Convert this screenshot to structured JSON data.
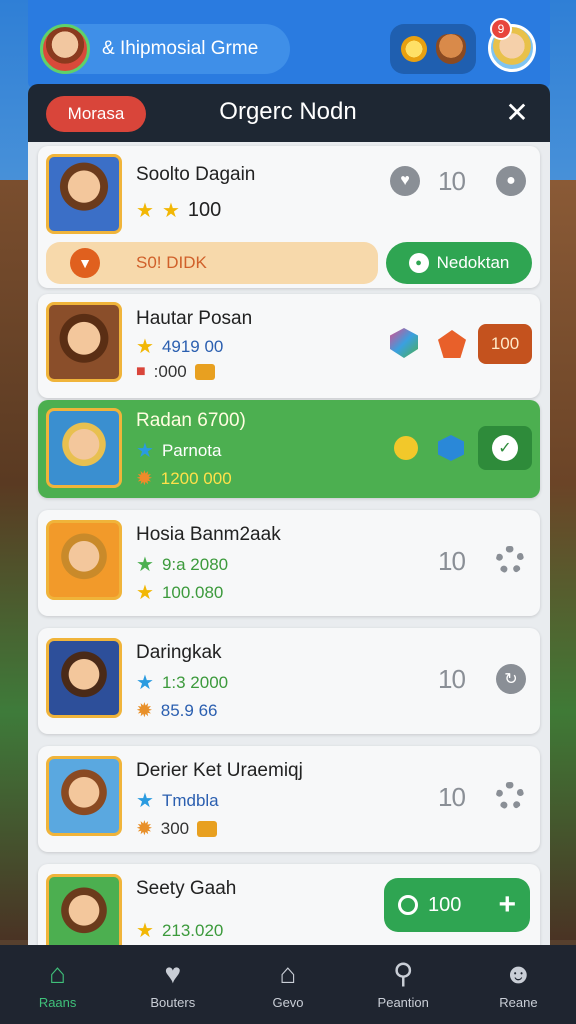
{
  "header": {
    "profile_name": "& Ihipmosial Grme",
    "notification_count": "9"
  },
  "panel": {
    "tag": "Morasa",
    "title": "Orgerc Nodn",
    "close": "✕"
  },
  "cards": [
    {
      "name": "Soolto Dagain",
      "stat1": "100",
      "count": "10",
      "status_text": "S0! DIDK",
      "action_label": "Nedoktan"
    },
    {
      "name": "Hautar Posan",
      "stat1": "4919 00",
      "stat2": ":000",
      "price": "100"
    },
    {
      "name": "Radan 6700)",
      "stat1": "Parnota",
      "stat2": "1200 000"
    },
    {
      "name": "Hosia Banm2aak",
      "stat1": "9:a 2080",
      "stat2": "100.080",
      "count": "10"
    },
    {
      "name": "Daringkak",
      "stat1": "1:3 2000",
      "stat2": "85.9 66",
      "count": "10"
    },
    {
      "name": "Derier Ket Uraemiqj",
      "stat1": "Tmdbla",
      "stat2": "300",
      "count": "10"
    },
    {
      "name": "Seety Gaah",
      "stat1": "213.020",
      "buy_value": "100",
      "buy_plus": "+"
    }
  ],
  "nav": [
    {
      "label": "Raans",
      "icon": "home-icon",
      "active": true
    },
    {
      "label": "Bouters",
      "icon": "heart-shield-icon",
      "active": false
    },
    {
      "label": "Gevo",
      "icon": "house-icon",
      "active": false
    },
    {
      "label": "Peantion",
      "icon": "search-icon",
      "active": false
    },
    {
      "label": "Reane",
      "icon": "user-icon",
      "active": false
    }
  ],
  "colors": {
    "primary_blue": "#2a7be0",
    "accent_green": "#4caf50",
    "danger_red": "#d9453a",
    "nav_bg": "#1f2530"
  }
}
